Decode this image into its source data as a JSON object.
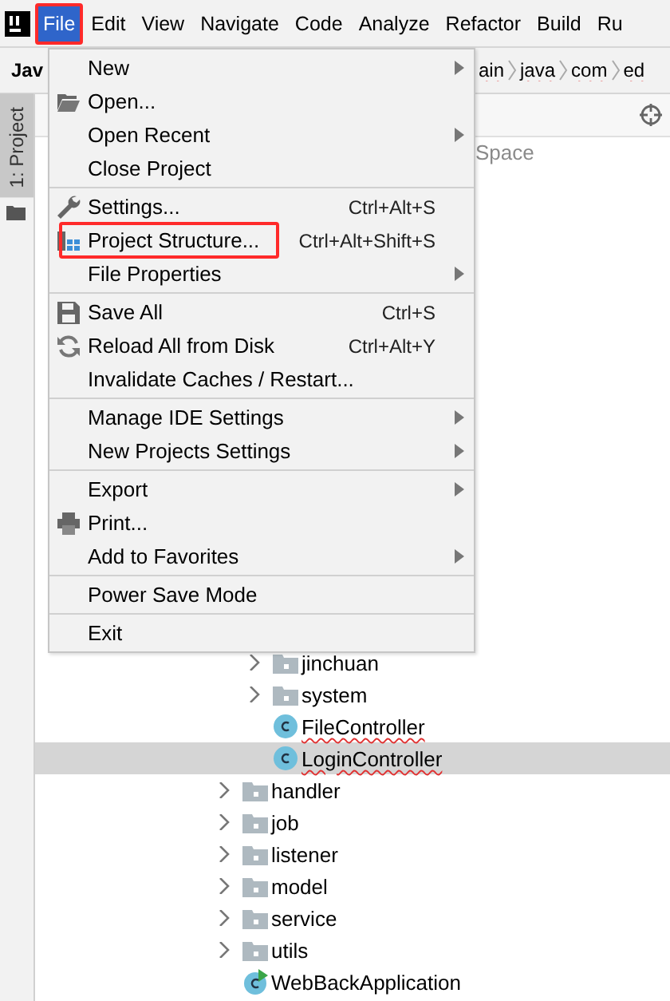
{
  "menu_bar": [
    {
      "label": "File",
      "selected": true,
      "annotated": true
    },
    {
      "label": "Edit",
      "selected": false,
      "annotated": false
    },
    {
      "label": "View",
      "selected": false,
      "annotated": false
    },
    {
      "label": "Navigate",
      "selected": false,
      "annotated": false
    },
    {
      "label": "Code",
      "selected": false,
      "annotated": false
    },
    {
      "label": "Analyze",
      "selected": false,
      "annotated": false
    },
    {
      "label": "Refactor",
      "selected": false,
      "annotated": false
    },
    {
      "label": "Build",
      "selected": false,
      "annotated": false
    },
    {
      "label": "Ru",
      "selected": false,
      "annotated": false
    }
  ],
  "navigation_bar": {
    "project": "Jav",
    "crumbs": [
      {
        "label": "ain",
        "misspelled": true
      },
      {
        "label": "java",
        "misspelled": true
      },
      {
        "label": "com",
        "misspelled": true
      },
      {
        "label": "ed",
        "misspelled": true
      }
    ]
  },
  "tool_strip": {
    "tabs": [
      {
        "label": "1: Project",
        "selected": true
      }
    ]
  },
  "project_panel": {
    "path_hint": "Space",
    "tree": [
      {
        "children": [
          {
            "label": "jinchuan",
            "kind": "folder",
            "expanded": false,
            "selected": false,
            "misspelled": false
          },
          {
            "label": "system",
            "kind": "folder",
            "expanded": false,
            "selected": false,
            "misspelled": false
          },
          {
            "label": "FileController",
            "kind": "class",
            "selected": false,
            "misspelled": true
          },
          {
            "label": "LoginController",
            "kind": "class",
            "selected": true,
            "misspelled": true
          }
        ]
      },
      {
        "label": "handler",
        "kind": "folder",
        "expanded": false,
        "selected": false,
        "misspelled": false
      },
      {
        "label": "job",
        "kind": "folder",
        "expanded": false,
        "selected": false,
        "misspelled": false
      },
      {
        "label": "listener",
        "kind": "folder",
        "expanded": false,
        "selected": false,
        "misspelled": false
      },
      {
        "label": "model",
        "kind": "folder",
        "expanded": false,
        "selected": false,
        "misspelled": false
      },
      {
        "label": "service",
        "kind": "folder",
        "expanded": false,
        "selected": false,
        "misspelled": false
      },
      {
        "label": "utils",
        "kind": "folder",
        "expanded": false,
        "selected": false,
        "misspelled": false
      },
      {
        "label": "WebBackApplication",
        "kind": "app",
        "selected": false,
        "misspelled": false
      }
    ]
  },
  "file_menu": {
    "groups": [
      {
        "items": [
          {
            "label": "New",
            "kind": "plain",
            "submenu": true
          },
          {
            "label": "Open...",
            "kind": "folder",
            "submenu": false
          },
          {
            "label": "Open Recent",
            "kind": "plain",
            "submenu": true
          },
          {
            "label": "Close Project",
            "kind": "plain",
            "submenu": false
          }
        ]
      },
      {
        "items": [
          {
            "label": "Settings...",
            "kind": "wrench",
            "shortcut": "Ctrl+Alt+S",
            "submenu": false
          },
          {
            "label": "Project Structure...",
            "kind": "structure",
            "shortcut": "Ctrl+Alt+Shift+S",
            "submenu": false,
            "annotated": true
          },
          {
            "label": "File Properties",
            "kind": "plain",
            "submenu": true
          }
        ]
      },
      {
        "items": [
          {
            "label": "Save All",
            "kind": "save",
            "shortcut": "Ctrl+S",
            "submenu": false
          },
          {
            "label": "Reload All from Disk",
            "kind": "reload",
            "shortcut": "Ctrl+Alt+Y",
            "submenu": false
          },
          {
            "label": "Invalidate Caches / Restart...",
            "kind": "plain",
            "submenu": false
          }
        ]
      },
      {
        "items": [
          {
            "label": "Manage IDE Settings",
            "kind": "plain",
            "submenu": true
          },
          {
            "label": "New Projects Settings",
            "kind": "plain",
            "submenu": true
          }
        ]
      },
      {
        "items": [
          {
            "label": "Export",
            "kind": "plain",
            "submenu": true
          },
          {
            "label": "Print...",
            "kind": "print",
            "submenu": false
          },
          {
            "label": "Add to Favorites",
            "kind": "plain",
            "submenu": true
          }
        ]
      },
      {
        "items": [
          {
            "label": "Power Save Mode",
            "kind": "plain",
            "submenu": false
          }
        ]
      },
      {
        "items": [
          {
            "label": "Exit",
            "kind": "plain",
            "submenu": false
          }
        ]
      }
    ]
  }
}
